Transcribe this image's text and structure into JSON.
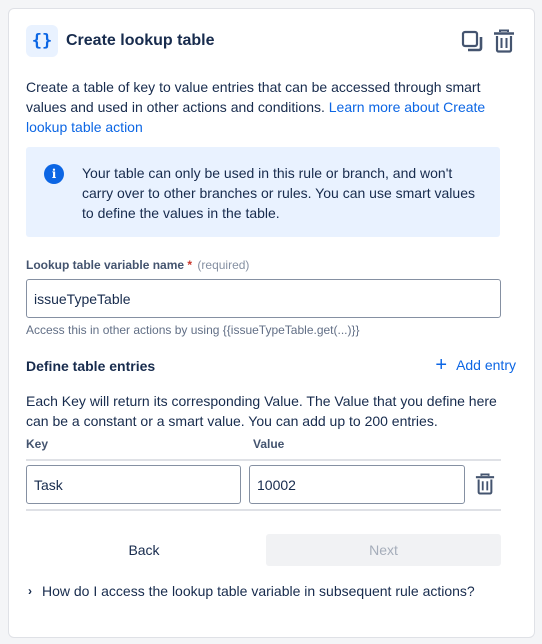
{
  "header": {
    "icon": "curly-braces-icon",
    "icon_glyph": "{}",
    "title": "Create lookup table",
    "actions": [
      "duplicate-icon",
      "trash-icon"
    ]
  },
  "description": {
    "text": "Create a table of key to value entries that can be accessed through smart values and used in other actions and conditions.",
    "link": "Learn more about Create lookup table action"
  },
  "info": {
    "icon": "info-icon",
    "text": "Your table can only be used in this rule or branch, and won't carry over to other branches or rules. You can use smart values to define the values in the table."
  },
  "variable_field": {
    "label": "Lookup table variable name",
    "required_star": "*",
    "required_text": "(required)",
    "value": "issueTypeTable",
    "helper": "Access this in other actions by using {{issueTypeTable.get(...)}}"
  },
  "entries": {
    "title": "Define table entries",
    "add_label": "Add entry",
    "description": "Each Key will return its corresponding Value. The Value that you define here can be a constant or a smart value. You can add up to 200 entries.",
    "columns": {
      "key": "Key",
      "value": "Value"
    },
    "rows": [
      {
        "key": "Task",
        "value": "10002"
      }
    ]
  },
  "footer": {
    "back_label": "Back",
    "next_label": "Next"
  },
  "faq": {
    "text": "How do I access the lookup table variable in subsequent rule actions?"
  },
  "colors": {
    "accent": "#0c66e4",
    "info_bg": "#e9f2ff",
    "required": "#c9372c"
  }
}
